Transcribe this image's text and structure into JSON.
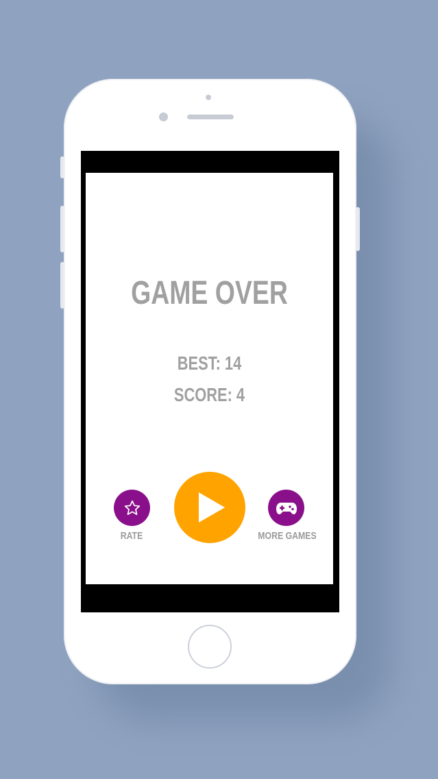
{
  "game": {
    "title": "GAME OVER",
    "best": "BEST: 14",
    "score": "SCORE: 4",
    "rate_label": "RATE",
    "more_games_label": "MORE GAMES"
  },
  "icons": {
    "rate": "star-icon",
    "play": "play-icon",
    "more_games": "gamepad-icon",
    "home": "home-button"
  },
  "colors": {
    "background": "#8fa3c0",
    "screen": "#ffffff",
    "text": "#a0a0a0",
    "accent_purple": "#8a0f8a",
    "accent_orange": "#ffa300"
  }
}
